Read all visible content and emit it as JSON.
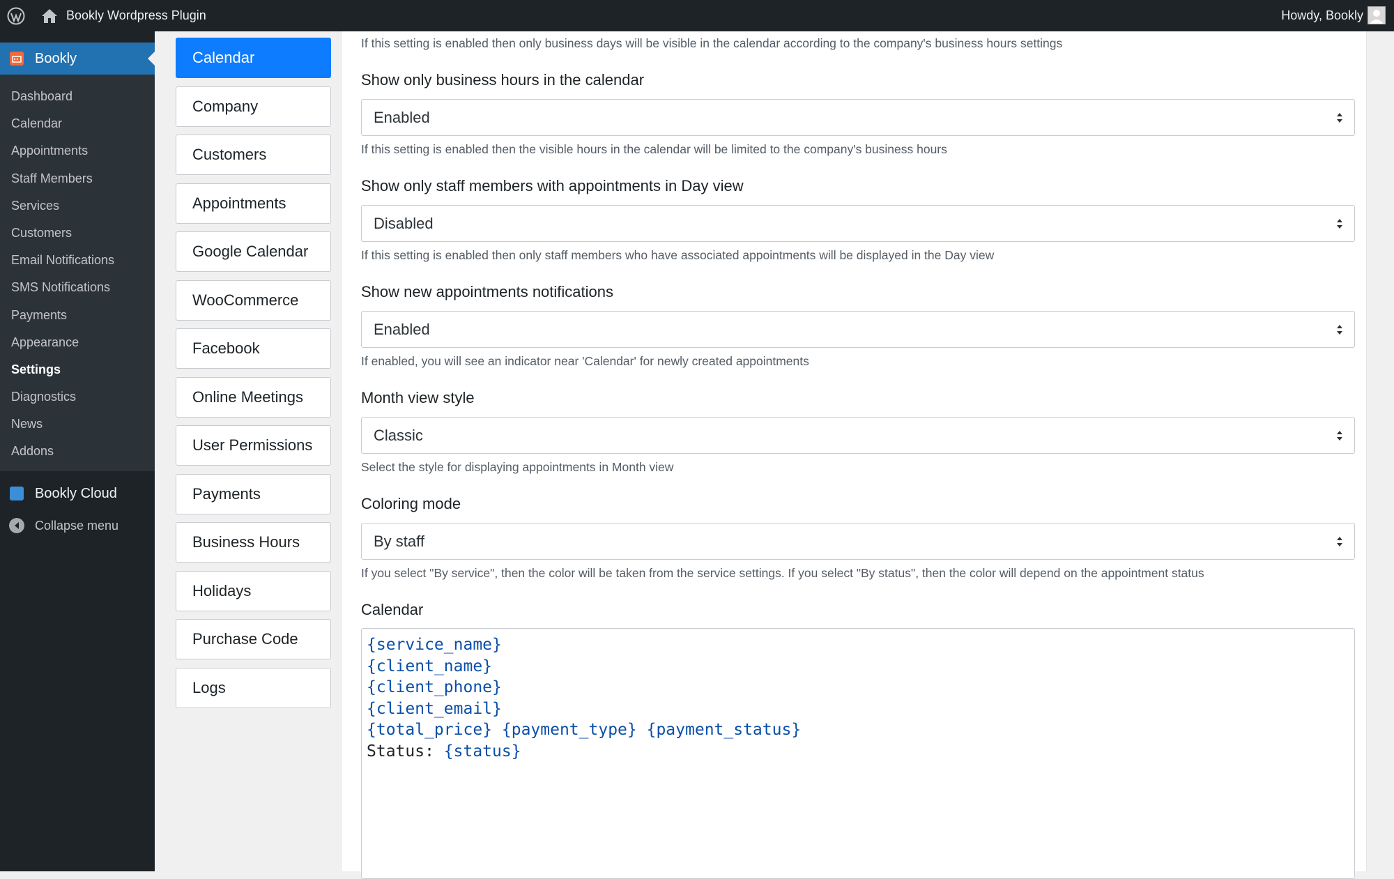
{
  "adminbar": {
    "site_name": "Bookly Wordpress Plugin",
    "howdy": "Howdy, Bookly"
  },
  "sidebar": {
    "current_label": "Bookly",
    "submenu": [
      {
        "label": "Dashboard"
      },
      {
        "label": "Calendar"
      },
      {
        "label": "Appointments"
      },
      {
        "label": "Staff Members"
      },
      {
        "label": "Services"
      },
      {
        "label": "Customers"
      },
      {
        "label": "Email Notifications"
      },
      {
        "label": "SMS Notifications"
      },
      {
        "label": "Payments"
      },
      {
        "label": "Appearance"
      },
      {
        "label": "Settings"
      },
      {
        "label": "Diagnostics"
      },
      {
        "label": "News"
      },
      {
        "label": "Addons"
      }
    ],
    "active_submenu": "Settings",
    "cloud_label": "Bookly Cloud",
    "collapse_label": "Collapse menu"
  },
  "tabs": [
    {
      "label": "Calendar"
    },
    {
      "label": "Company"
    },
    {
      "label": "Customers"
    },
    {
      "label": "Appointments"
    },
    {
      "label": "Google Calendar"
    },
    {
      "label": "WooCommerce"
    },
    {
      "label": "Facebook"
    },
    {
      "label": "Online Meetings"
    },
    {
      "label": "User Permissions"
    },
    {
      "label": "Payments"
    },
    {
      "label": "Business Hours"
    },
    {
      "label": "Holidays"
    },
    {
      "label": "Purchase Code"
    },
    {
      "label": "Logs"
    }
  ],
  "active_tab": "Calendar",
  "settings": {
    "top_help": "If this setting is enabled then only business days will be visible in the calendar according to the company's business hours settings",
    "business_hours": {
      "label": "Show only business hours in the calendar",
      "value": "Enabled",
      "help": "If this setting is enabled then the visible hours in the calendar will be limited to the company's business hours"
    },
    "staff_day_view": {
      "label": "Show only staff members with appointments in Day view",
      "value": "Disabled",
      "help": "If this setting is enabled then only staff members who have associated appointments will be displayed in the Day view"
    },
    "new_notifications": {
      "label": "Show new appointments notifications",
      "value": "Enabled",
      "help": "If enabled, you will see an indicator near 'Calendar' for newly created appointments"
    },
    "month_view_style": {
      "label": "Month view style",
      "value": "Classic",
      "help": "Select the style for displaying appointments in Month view"
    },
    "coloring_mode": {
      "label": "Coloring mode",
      "value": "By staff",
      "help": "If you select \"By service\", then the color will be taken from the service settings. If you select \"By status\", then the color will depend on the appointment status"
    },
    "calendar_template": {
      "label": "Calendar",
      "lines": [
        {
          "text": "",
          "codes": [
            "{service_name}"
          ]
        },
        {
          "text": "",
          "codes": [
            "{client_name}"
          ]
        },
        {
          "text": "",
          "codes": [
            "{client_phone}"
          ]
        },
        {
          "text": "",
          "codes": [
            "{client_email}"
          ]
        },
        {
          "text": "",
          "codes": [
            "{total_price}",
            "{payment_type}",
            "{payment_status}"
          ]
        },
        {
          "text": "Status: ",
          "codes": [
            "{status}"
          ]
        }
      ]
    }
  },
  "colors": {
    "adminbar_bg": "#1d2327",
    "sidebar_active": "#2271b1",
    "tab_active": "#0d7cff",
    "code_text": "#0a4fa8"
  }
}
